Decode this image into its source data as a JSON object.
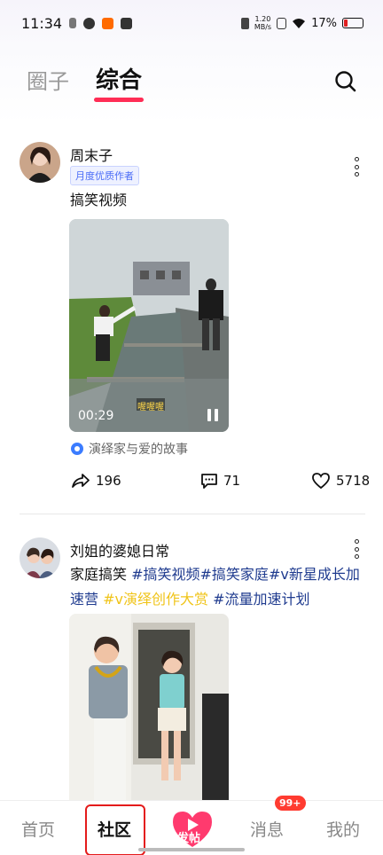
{
  "status_bar": {
    "time": "11:34",
    "net_speed_value": "1.20",
    "net_speed_unit": "MB/s",
    "battery": "17%"
  },
  "header": {
    "tabs": [
      {
        "label": "圈子",
        "active": false
      },
      {
        "label": "综合",
        "active": true
      }
    ],
    "search_icon": "search-icon"
  },
  "posts": [
    {
      "author": "周末子",
      "badge": "月度优质作者",
      "text": "搞笑视频",
      "video_duration": "00:29",
      "video_caption": "喔喔喔",
      "circle": "演绎家与爱的故事",
      "shares": "196",
      "comments": "71",
      "likes": "5718"
    },
    {
      "author": "刘姐的婆媳日常",
      "text_plain": "家庭搞笑 ",
      "hashtags": [
        {
          "text": "#搞笑视频",
          "color": "blue"
        },
        {
          "text": "#搞笑家庭",
          "color": "blue"
        },
        {
          "text": "#v新星成长加速营",
          "color": "blue"
        },
        {
          "text": "#v演绎创作大赏",
          "color": "yellow"
        },
        {
          "text": "#流量加速计划",
          "color": "blue"
        }
      ]
    }
  ],
  "bottom_nav": {
    "items": [
      {
        "label": "首页",
        "active": false
      },
      {
        "label": "社区",
        "active": true
      },
      {
        "label": "发帖",
        "active": false
      },
      {
        "label": "消息",
        "active": false
      },
      {
        "label": "我的",
        "active": false
      }
    ],
    "message_badge": "99+"
  },
  "colors": {
    "accent": "#ff2d55",
    "hashtag_blue": "#1f3b8f",
    "hashtag_yellow": "#f0c419",
    "badge_blue": "#4a6cf7"
  }
}
